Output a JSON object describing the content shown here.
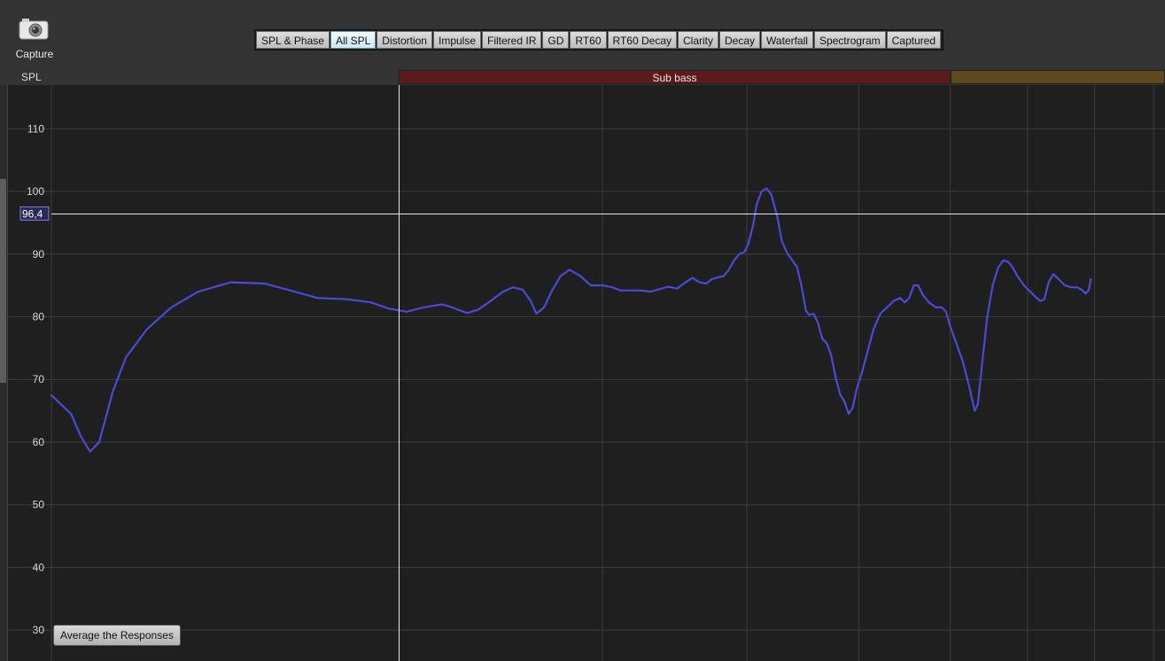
{
  "capture": {
    "label": "Capture",
    "icon": "camera-icon"
  },
  "axis_title": "SPL",
  "tabs": [
    {
      "label": "SPL & Phase",
      "active": false
    },
    {
      "label": "All SPL",
      "active": true
    },
    {
      "label": "Distortion",
      "active": false
    },
    {
      "label": "Impulse",
      "active": false
    },
    {
      "label": "Filtered IR",
      "active": false
    },
    {
      "label": "GD",
      "active": false
    },
    {
      "label": "RT60",
      "active": false
    },
    {
      "label": "RT60 Decay",
      "active": false
    },
    {
      "label": "Clarity",
      "active": false
    },
    {
      "label": "Decay",
      "active": false
    },
    {
      "label": "Waterfall",
      "active": false
    },
    {
      "label": "Spectrogram",
      "active": false
    },
    {
      "label": "Captured",
      "active": false
    }
  ],
  "bands": [
    {
      "label": "Sub bass",
      "from": 20,
      "to": 60,
      "color": "#5c1a1a"
    },
    {
      "label": "",
      "from": 60,
      "to": 120,
      "color": "#5e4a1c"
    }
  ],
  "colors": {
    "background": "#1f1f1f",
    "grid": "#3d3d3d",
    "curve": "#4a4ad6",
    "cursor": "#e8e8e8"
  },
  "cursor": {
    "y_label": "96,4",
    "y": 96.4,
    "x": 20
  },
  "average_button": "Average the Responses",
  "chart_data": {
    "type": "line",
    "xscale": "log",
    "xlim": [
      10,
      120
    ],
    "ylim": [
      25.5,
      114
    ],
    "yticks": [
      30,
      40,
      50,
      60,
      70,
      80,
      90,
      100,
      110
    ],
    "xgrid": [
      10,
      20,
      30,
      40,
      50,
      60,
      70,
      80,
      90,
      100
    ],
    "series": [
      {
        "points": [
          [
            10,
            67.5
          ],
          [
            10.4,
            64.5
          ],
          [
            10.6,
            61
          ],
          [
            10.8,
            58.5
          ],
          [
            11.0,
            60
          ],
          [
            11.3,
            68
          ],
          [
            11.6,
            73.5
          ],
          [
            12.1,
            78
          ],
          [
            12.7,
            81.5
          ],
          [
            13.4,
            84
          ],
          [
            14.3,
            85.5
          ],
          [
            15.3,
            85.3
          ],
          [
            16.1,
            84.2
          ],
          [
            17.0,
            83
          ],
          [
            18.0,
            82.8
          ],
          [
            18.9,
            82.3
          ],
          [
            19.6,
            81.3
          ],
          [
            20.3,
            80.8
          ],
          [
            21.0,
            81.5
          ],
          [
            21.8,
            82
          ],
          [
            22.3,
            81.4
          ],
          [
            22.9,
            80.6
          ],
          [
            23.4,
            81.1
          ],
          [
            24.0,
            82.5
          ],
          [
            24.6,
            84
          ],
          [
            25.1,
            84.7
          ],
          [
            25.6,
            84.3
          ],
          [
            26.0,
            82.5
          ],
          [
            26.3,
            80.5
          ],
          [
            26.7,
            81.5
          ],
          [
            27.1,
            84
          ],
          [
            27.6,
            86.5
          ],
          [
            28.1,
            87.5
          ],
          [
            28.7,
            86.5
          ],
          [
            29.3,
            85
          ],
          [
            30.0,
            85
          ],
          [
            30.6,
            84.7
          ],
          [
            31.1,
            84.2
          ],
          [
            31.7,
            84.2
          ],
          [
            32.4,
            84.2
          ],
          [
            33.0,
            84
          ],
          [
            33.6,
            84.4
          ],
          [
            34.2,
            84.8
          ],
          [
            34.8,
            84.5
          ],
          [
            35.4,
            85.5
          ],
          [
            35.9,
            86.2
          ],
          [
            36.4,
            85.5
          ],
          [
            36.9,
            85.3
          ],
          [
            37.3,
            86
          ],
          [
            37.8,
            86.3
          ],
          [
            38.2,
            86.5
          ],
          [
            38.6,
            87.5
          ],
          [
            39.0,
            89
          ],
          [
            39.4,
            90
          ],
          [
            39.8,
            90.3
          ],
          [
            40.1,
            91.5
          ],
          [
            40.5,
            94.5
          ],
          [
            40.8,
            98
          ],
          [
            41.2,
            100
          ],
          [
            41.6,
            100.5
          ],
          [
            42.0,
            99.5
          ],
          [
            42.5,
            96
          ],
          [
            42.9,
            92
          ],
          [
            43.4,
            90
          ],
          [
            43.8,
            89
          ],
          [
            44.2,
            88
          ],
          [
            44.6,
            85
          ],
          [
            45.0,
            81
          ],
          [
            45.3,
            80.3
          ],
          [
            45.7,
            80.5
          ],
          [
            46.1,
            79
          ],
          [
            46.5,
            76.5
          ],
          [
            46.9,
            75.8
          ],
          [
            47.3,
            74
          ],
          [
            47.8,
            70
          ],
          [
            48.2,
            67.5
          ],
          [
            48.6,
            66.5
          ],
          [
            49.0,
            64.5
          ],
          [
            49.4,
            65.5
          ],
          [
            49.8,
            68.5
          ],
          [
            50.3,
            71
          ],
          [
            50.9,
            74.5
          ],
          [
            51.5,
            78
          ],
          [
            52.2,
            80.5
          ],
          [
            52.9,
            81.5
          ],
          [
            53.6,
            82.5
          ],
          [
            54.3,
            83
          ],
          [
            54.8,
            82.3
          ],
          [
            55.3,
            83
          ],
          [
            55.8,
            85
          ],
          [
            56.3,
            85
          ],
          [
            56.8,
            83.5
          ],
          [
            57.5,
            82.3
          ],
          [
            58.3,
            81.5
          ],
          [
            59.0,
            81.5
          ],
          [
            59.5,
            80.8
          ],
          [
            60.0,
            78.5
          ],
          [
            61.5,
            73
          ],
          [
            62.3,
            69
          ],
          [
            63.0,
            65
          ],
          [
            63.4,
            66
          ],
          [
            63.9,
            72
          ],
          [
            64.6,
            80
          ],
          [
            65.3,
            85
          ],
          [
            66.0,
            87.8
          ],
          [
            66.7,
            89
          ],
          [
            67.3,
            88.8
          ],
          [
            67.9,
            88
          ],
          [
            68.6,
            86.5
          ],
          [
            69.5,
            85
          ],
          [
            70.4,
            84
          ],
          [
            71.3,
            83
          ],
          [
            71.8,
            82.5
          ],
          [
            72.4,
            82.8
          ],
          [
            73.0,
            85.5
          ],
          [
            73.7,
            86.8
          ],
          [
            74.5,
            86
          ],
          [
            75.4,
            85
          ],
          [
            76.4,
            84.7
          ],
          [
            77.3,
            84.7
          ],
          [
            78.0,
            84.3
          ],
          [
            78.6,
            83.7
          ],
          [
            79.1,
            84.3
          ],
          [
            79.4,
            86
          ]
        ]
      }
    ]
  }
}
